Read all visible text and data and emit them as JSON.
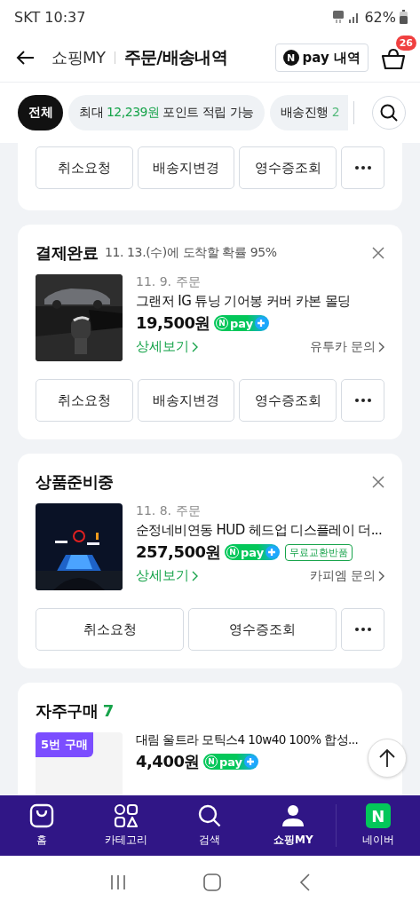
{
  "status_bar": {
    "carrier_time": "SKT 10:37",
    "battery": "62%"
  },
  "header": {
    "breadcrumb": "쇼핑MY",
    "title": "주문/배송내역",
    "npay_button": {
      "logo": "N",
      "label": "pay 내역"
    },
    "cart_count": "26"
  },
  "filters": [
    {
      "kind": "plain",
      "label": "전체",
      "selected": true
    },
    {
      "kind": "points",
      "parts": [
        "최대 ",
        "12,239원",
        " 포인트 적립 가능"
      ],
      "selected": false
    },
    {
      "kind": "count",
      "label": "배송진행",
      "count": "2",
      "selected": false
    }
  ],
  "orders": [
    {
      "actions": [
        "취소요청",
        "배송지변경",
        "영수증조회"
      ]
    },
    {
      "status": "결제완료",
      "eta": "11. 13.(수)에 도착할 확률 95%",
      "order_date": "11. 9. 주문",
      "name": "그랜저 IG 튜닝 기어봉 커버 카본 몰딩",
      "price": "19,500원",
      "npay": {
        "logo": "N",
        "label": "pay"
      },
      "detail_link": "상세보기",
      "seller_link": "유투카 문의",
      "actions": [
        "취소요청",
        "배송지변경",
        "영수증조회"
      ]
    },
    {
      "status": "상품준비중",
      "order_date": "11. 8. 주문",
      "name": "순정네비연동 HUD 헤드업 디스플레이 더...",
      "price": "257,500원",
      "npay": {
        "logo": "N",
        "label": "pay"
      },
      "tags": [
        "무료교환반품"
      ],
      "detail_link": "상세보기",
      "seller_link": "카피엠 문의",
      "actions": [
        "취소요청",
        "영수증조회"
      ]
    }
  ],
  "frequent": {
    "title": "자주구매",
    "count": "7",
    "items": [
      {
        "badge": "5번 구매",
        "name": "대림 울트라 모틱스4 10w40 100% 합성...",
        "price": "4,400원",
        "npay": {
          "logo": "N",
          "label": "pay"
        }
      }
    ]
  },
  "nav": [
    {
      "label": "홈",
      "selected": false
    },
    {
      "label": "카테고리",
      "selected": false
    },
    {
      "label": "검색",
      "selected": false
    },
    {
      "label": "쇼핑MY",
      "selected": true
    },
    {
      "logo": "N",
      "label": "네이버",
      "selected": false
    }
  ]
}
